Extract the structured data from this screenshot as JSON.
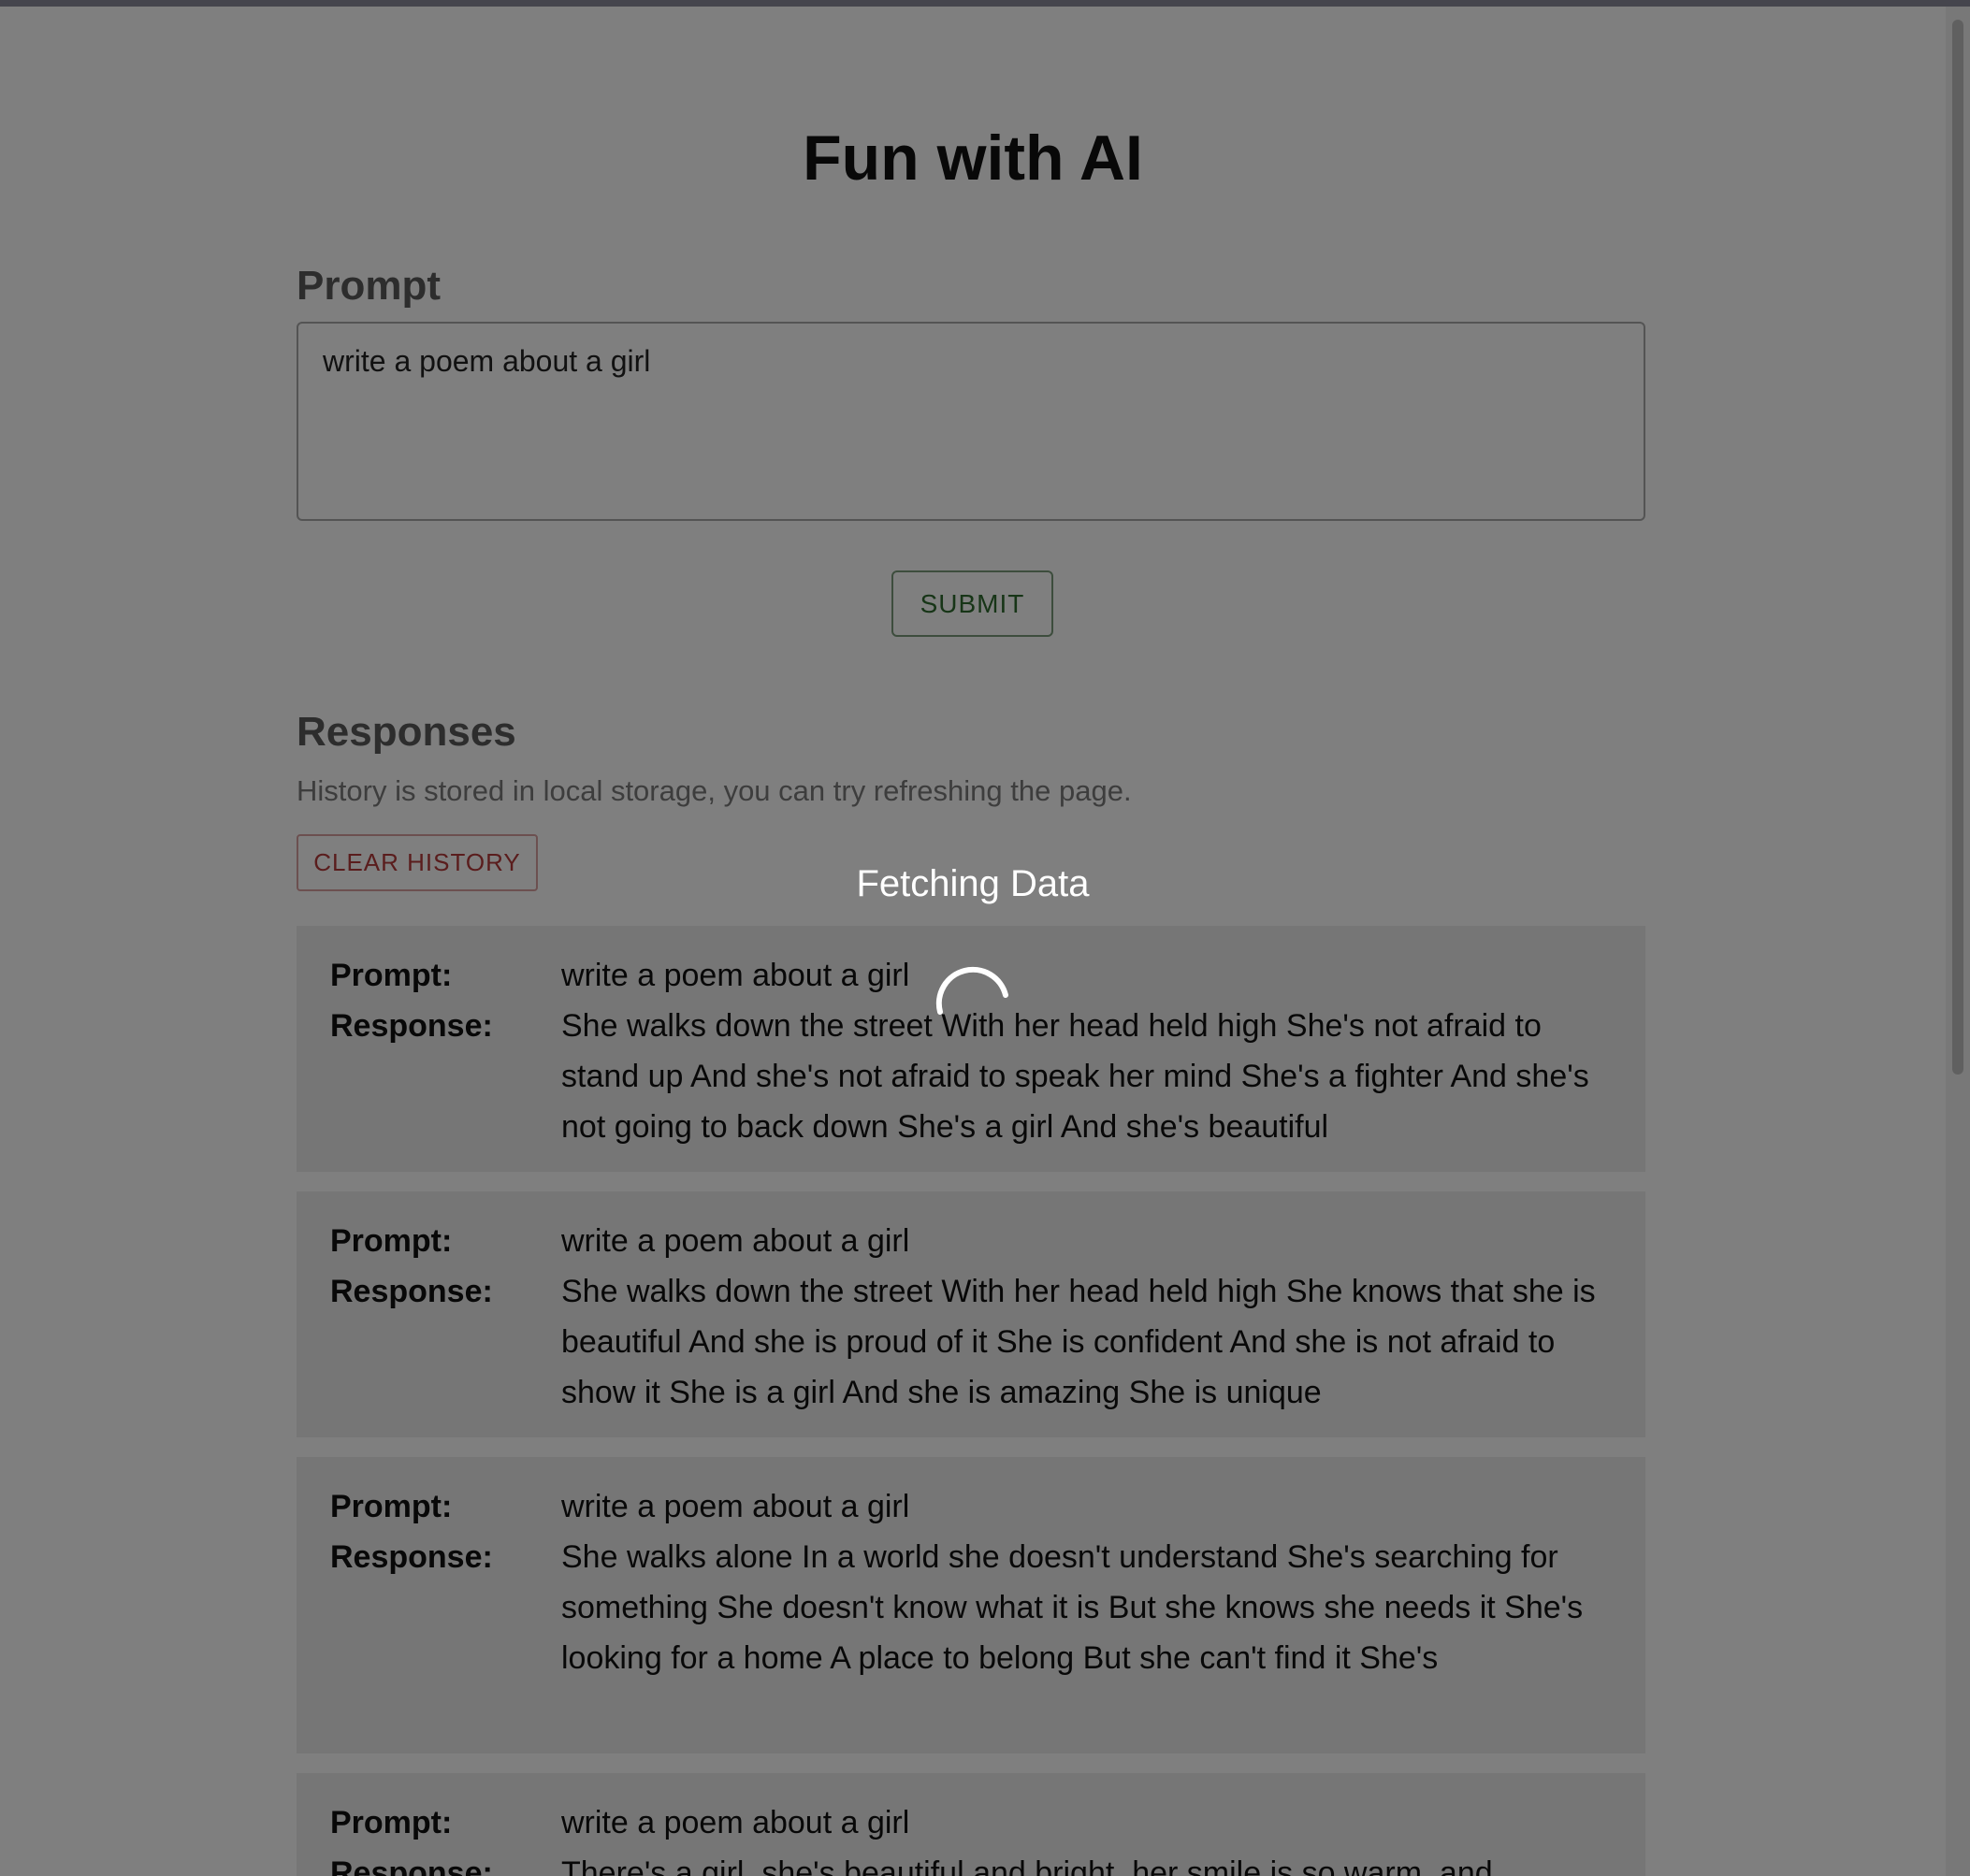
{
  "app": {
    "title": "Fun with AI"
  },
  "prompt_section": {
    "heading": "Prompt",
    "input_value": "write a poem about a girl",
    "submit_label": "SUBMIT"
  },
  "responses_section": {
    "heading": "Responses",
    "note": "History is stored in local storage, you can try refreshing the page.",
    "clear_label": "CLEAR HISTORY",
    "prompt_label": "Prompt:",
    "response_label": "Response:",
    "items": [
      {
        "prompt": "write a poem about a girl",
        "response": "She walks down the street With her head held high She's not afraid to stand up And she's not afraid to speak her mind She's a fighter And she's not going to back down She's a girl And she's beautiful"
      },
      {
        "prompt": "write a poem about a girl",
        "response": "She walks down the street With her head held high She knows that she is beautiful And she is proud of it She is confident And she is not afraid to show it She is a girl And she is amazing She is unique"
      },
      {
        "prompt": "write a poem about a girl",
        "response": "She walks alone In a world she doesn't understand She's searching for something She doesn't know what it is But she knows she needs it She's looking for a home A place to belong But she can't find it She's"
      },
      {
        "prompt": "write a poem about a girl",
        "response": "There's a girl, she's beautiful and bright, her smile is so warm, and"
      }
    ]
  },
  "loading_overlay": {
    "text": "Fetching Data",
    "spinner_icon": "spinner-icon"
  },
  "colors": {
    "submit_accent": "#2f6b2f",
    "clear_accent": "#b43a3a",
    "overlay": "rgba(0,0,0,0.5)"
  }
}
